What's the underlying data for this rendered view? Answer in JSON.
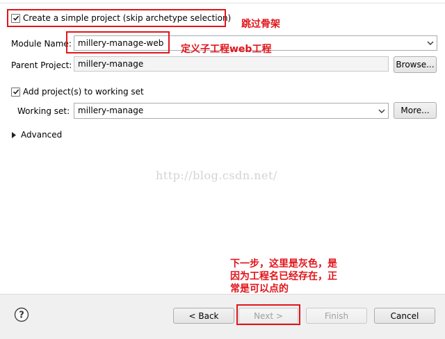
{
  "options": {
    "create_simple": {
      "label": "Create a simple project (skip archetype selection)",
      "checked": true
    },
    "add_working_set": {
      "label": "Add project(s) to working set",
      "checked": true
    },
    "advanced": {
      "label": "Advanced"
    }
  },
  "fields": {
    "module_name": {
      "label": "Module Name:",
      "value": "millery-manage-web"
    },
    "parent_project": {
      "label": "Parent Project:",
      "value": "millery-manage",
      "button": "Browse..."
    },
    "working_set": {
      "label": "Working set:",
      "value": "millery-manage",
      "button": "More..."
    }
  },
  "buttons": {
    "back": "< Back",
    "next": "Next >",
    "finish": "Finish",
    "cancel": "Cancel"
  },
  "watermark": "http://blog.csdn.net/",
  "annotations": {
    "skip_archetype": "跳过骨架",
    "define_module": "定义子工程web工程",
    "next_note_1": "下一步，这里是灰色，是",
    "next_note_2": "因为工程名已经存在，正",
    "next_note_3": "常是可以点的"
  },
  "colors": {
    "annotation_red": "#e0151b",
    "disabled_text": "#a0a0a0"
  }
}
